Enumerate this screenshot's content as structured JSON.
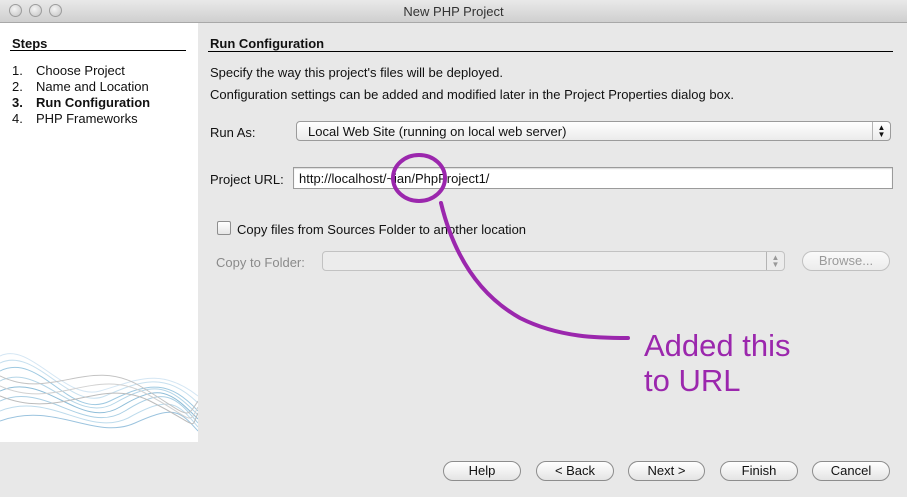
{
  "window": {
    "title": "New PHP Project"
  },
  "steps": {
    "heading": "Steps",
    "items": [
      {
        "num": "1.",
        "label": "Choose Project",
        "active": false
      },
      {
        "num": "2.",
        "label": "Name and Location",
        "active": false
      },
      {
        "num": "3.",
        "label": "Run Configuration",
        "active": true
      },
      {
        "num": "4.",
        "label": "PHP Frameworks",
        "active": false
      }
    ]
  },
  "main": {
    "heading": "Run Configuration",
    "description_line1": "Specify the way this project's files will be deployed.",
    "description_line2": "Configuration settings can be added and modified later in the Project Properties dialog box.",
    "run_as": {
      "label": "Run As:",
      "value": "Local Web Site (running on local web server)"
    },
    "project_url": {
      "label": "Project URL:",
      "value": "http://localhost/~ian/PhpProject1/"
    },
    "copy_files": {
      "label": "Copy files from Sources Folder to another location",
      "checked": false
    },
    "copy_to_folder": {
      "label": "Copy to Folder:",
      "value": "",
      "enabled": false
    },
    "browse_label": "Browse..."
  },
  "annotation": {
    "text": "Added this\nto URL",
    "color": "#9b27ad"
  },
  "footer": {
    "help_label": "Help",
    "back_label": "< Back",
    "next_label": "Next >",
    "finish_label": "Finish",
    "cancel_label": "Cancel"
  }
}
